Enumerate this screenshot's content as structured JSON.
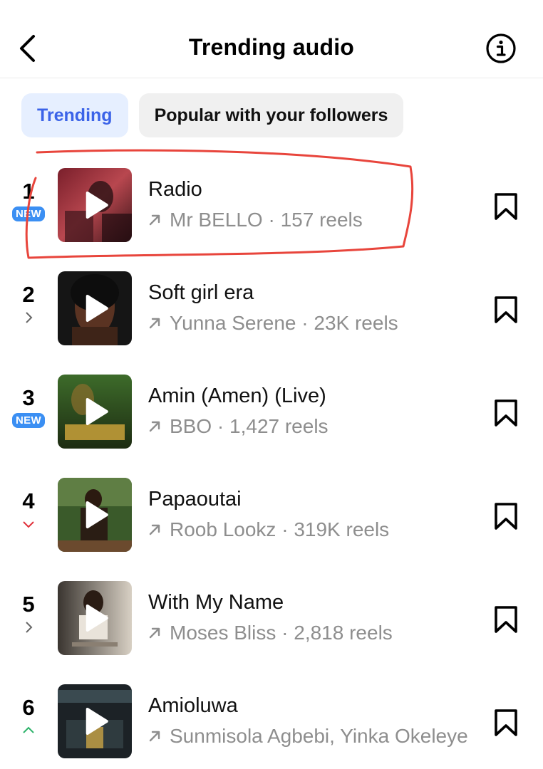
{
  "header": {
    "title": "Trending audio",
    "back_icon": "chevron-left-icon",
    "info_icon": "info-icon"
  },
  "tabs": [
    {
      "label": "Trending",
      "active": true
    },
    {
      "label": "Popular with your followers",
      "active": false
    }
  ],
  "colors": {
    "accent": "#3b63e8",
    "new_badge": "#3b8ff3",
    "trend_down": "#e0303a",
    "trend_up": "#2db36a",
    "muted_text": "#8e8e8e",
    "annotation": "#e8453c"
  },
  "tracks": [
    {
      "rank": "1",
      "status": "new",
      "badge": "NEW",
      "title": "Radio",
      "meta": "Mr BELLO · 157 reels"
    },
    {
      "rank": "2",
      "status": "same",
      "title": "Soft girl era",
      "meta": "Yunna Serene · 23K reels"
    },
    {
      "rank": "3",
      "status": "new",
      "badge": "NEW",
      "title": "Amin (Amen) (Live)",
      "meta": "BBO · 1,427 reels"
    },
    {
      "rank": "4",
      "status": "down",
      "title": "Papaoutai",
      "meta": "Roob Lookz · 319K reels"
    },
    {
      "rank": "5",
      "status": "same",
      "title": "With My Name",
      "meta": "Moses Bliss · 2,818 reels"
    },
    {
      "rank": "6",
      "status": "up",
      "title": "Amioluwa",
      "meta": "Sunmisola Agbebi, Yinka Okeleye"
    }
  ]
}
